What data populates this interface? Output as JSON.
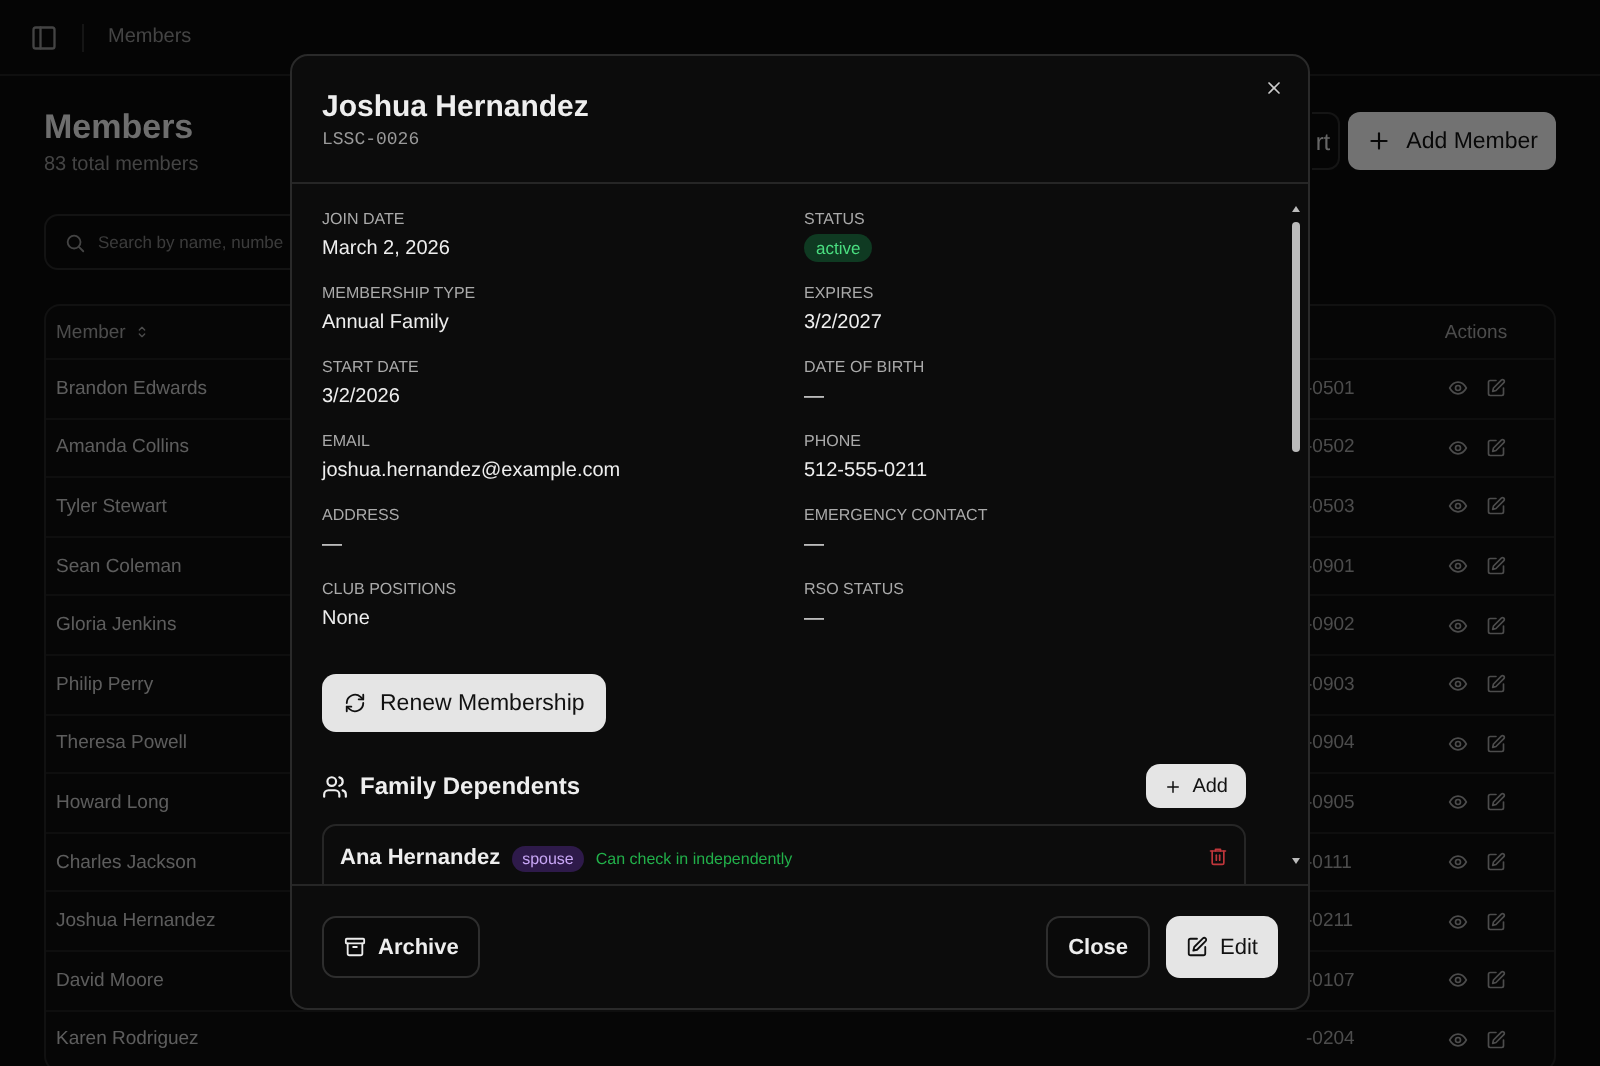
{
  "topbar": {
    "breadcrumb": "Members"
  },
  "page": {
    "title": "Members",
    "subtitle": "83 total members",
    "search": {
      "placeholder": "Search by name, numbe"
    },
    "export_button": "rt",
    "add_button": "Add Member"
  },
  "table": {
    "columns": [
      "Member",
      "Actions"
    ],
    "rows": [
      {
        "name": "Brandon Edwards",
        "phone": "-0501"
      },
      {
        "name": "Amanda Collins",
        "phone": "-0502"
      },
      {
        "name": "Tyler Stewart",
        "phone": "-0503"
      },
      {
        "name": "Sean Coleman",
        "phone": "-0901"
      },
      {
        "name": "Gloria Jenkins",
        "phone": "-0902"
      },
      {
        "name": "Philip Perry",
        "phone": "-0903"
      },
      {
        "name": "Theresa Powell",
        "phone": "-0904"
      },
      {
        "name": "Howard Long",
        "phone": "-0905"
      },
      {
        "name": "Charles Jackson",
        "phone": "-0111"
      },
      {
        "name": "Joshua Hernandez",
        "phone": "-0211"
      },
      {
        "name": "David Moore",
        "phone": "-0107"
      },
      {
        "name": "Karen Rodriguez",
        "phone": "-0204"
      }
    ]
  },
  "dialog": {
    "title": "Joshua Hernandez",
    "member_id": "LSSC-0026",
    "fields": [
      {
        "label": "JOIN DATE",
        "value": "March 2, 2026",
        "kind": "text"
      },
      {
        "label": "STATUS",
        "value": "active",
        "kind": "badge"
      },
      {
        "label": "MEMBERSHIP TYPE",
        "value": "Annual Family",
        "kind": "text"
      },
      {
        "label": "EXPIRES",
        "value": "3/2/2027",
        "kind": "text"
      },
      {
        "label": "START DATE",
        "value": "3/2/2026",
        "kind": "text"
      },
      {
        "label": "DATE OF BIRTH",
        "value": "—",
        "kind": "text"
      },
      {
        "label": "EMAIL",
        "value": "joshua.hernandez@example.com",
        "kind": "text"
      },
      {
        "label": "PHONE",
        "value": "512-555-0211",
        "kind": "text"
      },
      {
        "label": "ADDRESS",
        "value": "—",
        "kind": "text"
      },
      {
        "label": "EMERGENCY CONTACT",
        "value": "—",
        "kind": "text"
      },
      {
        "label": "CLUB POSITIONS",
        "value": "None",
        "kind": "text"
      },
      {
        "label": "RSO STATUS",
        "value": "—",
        "kind": "text"
      }
    ],
    "renew_button": "Renew Membership",
    "dependents_title": "Family Dependents",
    "add_dependent_button": "Add",
    "dependents": [
      {
        "name": "Ana Hernandez",
        "relation": "spouse",
        "note": "Can check in independently"
      }
    ],
    "archive_button": "Archive",
    "close_button": "Close",
    "edit_button": "Edit"
  }
}
